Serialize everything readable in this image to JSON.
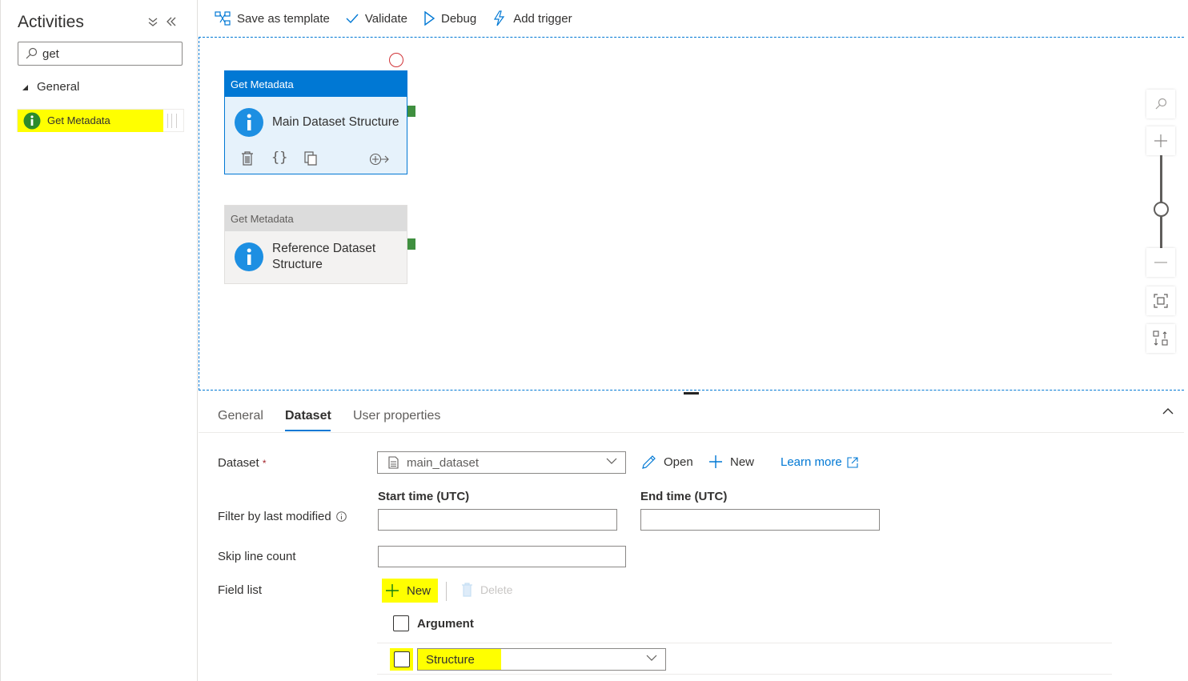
{
  "sidebar": {
    "title": "Activities",
    "search": {
      "value": "get",
      "placeholder": ""
    },
    "group": {
      "label": "General"
    },
    "activity": {
      "label": "Get Metadata"
    }
  },
  "toolbar": {
    "save_template": "Save as template",
    "validate": "Validate",
    "debug": "Debug",
    "add_trigger": "Add trigger"
  },
  "canvas": {
    "nodes": [
      {
        "type": "Get Metadata",
        "name": "Main Dataset Structure",
        "selected": true
      },
      {
        "type": "Get Metadata",
        "name_line1": "Reference Dataset",
        "name_line2": "Structure",
        "selected": false
      }
    ]
  },
  "panel": {
    "tabs": [
      "General",
      "Dataset",
      "User properties"
    ],
    "active_tab": "Dataset",
    "dataset": {
      "label": "Dataset",
      "required_mark": "*",
      "value": "main_dataset",
      "open": "Open",
      "new": "New",
      "learn_more": "Learn more"
    },
    "filter": {
      "label": "Filter by last modified",
      "start_label": "Start time (UTC)",
      "end_label": "End time (UTC)",
      "start_value": "",
      "end_value": ""
    },
    "skip_line_count": {
      "label": "Skip line count",
      "value": ""
    },
    "field_list": {
      "label": "Field list",
      "new": "New",
      "delete": "Delete",
      "header": "Argument",
      "rows": [
        {
          "value": "Structure"
        }
      ]
    }
  },
  "colors": {
    "accent": "#0078d4",
    "highlight": "#ffff00",
    "port": "#3f8f3f",
    "error": "#d13438"
  }
}
